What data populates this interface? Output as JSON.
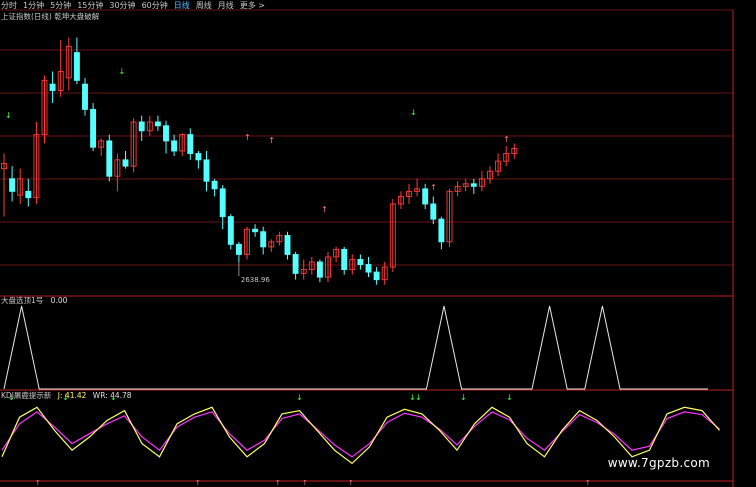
{
  "tabs": [
    "分时",
    "1分钟",
    "5分钟",
    "15分钟",
    "30分钟",
    "60分钟",
    "日线",
    "周线",
    "月线",
    "更多 >"
  ],
  "active_tab": "日线",
  "main_panel": {
    "title": "上证指数(日线) 乾坤大盘破解",
    "low_label": "2638.96"
  },
  "sub1": {
    "title": "大盘选顶1号",
    "value": "0.00"
  },
  "sub2": {
    "title": "KDJ屠鹿提示新",
    "j_label": "J: 41.42",
    "wr_label": "WR: 44.78"
  },
  "watermark": "www.7gpzb.com",
  "colors": {
    "up": "#ff3b3b",
    "down": "#54ffff",
    "grid": "#8b1a1a",
    "k_line": "#ffff66",
    "d_line": "#ff33ff",
    "arrow_green": "#3cff3c",
    "arrow_pink": "#ff7b8a"
  },
  "chart_data": [
    {
      "type": "candlestick",
      "title": "上证指数(日线) 乾坤大盘破解",
      "labeled_low": 2638.96,
      "candles_approx": [
        [
          0,
          158,
          162,
          120,
          170
        ],
        [
          1,
          150,
          140,
          132,
          160
        ],
        [
          2,
          137,
          150,
          130,
          158
        ],
        [
          3,
          140,
          135,
          128,
          150
        ],
        [
          4,
          135,
          185,
          130,
          195
        ],
        [
          5,
          185,
          228,
          178,
          232
        ],
        [
          6,
          225,
          220,
          210,
          235
        ],
        [
          7,
          220,
          235,
          215,
          260
        ],
        [
          8,
          230,
          255,
          220,
          262
        ],
        [
          9,
          250,
          228,
          225,
          262
        ],
        [
          10,
          225,
          205,
          200,
          230
        ],
        [
          11,
          205,
          175,
          172,
          210
        ],
        [
          12,
          175,
          180,
          168,
          182
        ],
        [
          13,
          180,
          152,
          148,
          185
        ],
        [
          14,
          152,
          165,
          140,
          170
        ],
        [
          15,
          165,
          160,
          158,
          172
        ],
        [
          16,
          160,
          195,
          155,
          198
        ],
        [
          17,
          195,
          188,
          180,
          200
        ],
        [
          18,
          188,
          195,
          184,
          200
        ],
        [
          19,
          195,
          192,
          188,
          200
        ],
        [
          20,
          192,
          180,
          170,
          196
        ],
        [
          21,
          180,
          172,
          168,
          185
        ],
        [
          22,
          172,
          185,
          168,
          186
        ],
        [
          23,
          185,
          170,
          165,
          190
        ],
        [
          24,
          170,
          165,
          158,
          172
        ],
        [
          25,
          165,
          148,
          140,
          172
        ],
        [
          26,
          148,
          142,
          136,
          150
        ],
        [
          27,
          142,
          120,
          110,
          145
        ],
        [
          28,
          120,
          98,
          94,
          122
        ],
        [
          29,
          98,
          90,
          84,
          100
        ],
        [
          30,
          90,
          110,
          86,
          112
        ],
        [
          31,
          110,
          108,
          104,
          114
        ],
        [
          32,
          108,
          96,
          90,
          112
        ],
        [
          33,
          96,
          100,
          92,
          102
        ],
        [
          34,
          100,
          105,
          97,
          108
        ],
        [
          35,
          105,
          90,
          86,
          108
        ],
        [
          36,
          90,
          75,
          70,
          92
        ],
        [
          37,
          75,
          78,
          70,
          86
        ],
        [
          38,
          78,
          84,
          74,
          88
        ],
        [
          39,
          84,
          72,
          68,
          86
        ],
        [
          40,
          72,
          88,
          68,
          92
        ],
        [
          41,
          88,
          94,
          84,
          96
        ],
        [
          42,
          94,
          78,
          74,
          96
        ],
        [
          43,
          78,
          86,
          74,
          90
        ],
        [
          44,
          86,
          82,
          78,
          90
        ],
        [
          45,
          82,
          76,
          72,
          88
        ],
        [
          46,
          76,
          70,
          66,
          80
        ],
        [
          47,
          70,
          80,
          66,
          84
        ],
        [
          48,
          80,
          130,
          76,
          134
        ],
        [
          49,
          130,
          136,
          126,
          140
        ],
        [
          50,
          136,
          140,
          130,
          146
        ],
        [
          51,
          140,
          142,
          136,
          150
        ],
        [
          52,
          142,
          130,
          126,
          146
        ],
        [
          53,
          130,
          118,
          114,
          136
        ],
        [
          54,
          118,
          100,
          94,
          120
        ],
        [
          55,
          100,
          140,
          96,
          142
        ],
        [
          56,
          140,
          144,
          136,
          148
        ],
        [
          57,
          144,
          146,
          140,
          150
        ],
        [
          58,
          146,
          144,
          138,
          150
        ],
        [
          59,
          144,
          150,
          140,
          156
        ],
        [
          60,
          150,
          156,
          146,
          160
        ],
        [
          61,
          156,
          164,
          152,
          170
        ],
        [
          62,
          164,
          170,
          160,
          176
        ],
        [
          63,
          170,
          174,
          166,
          178
        ]
      ]
    },
    {
      "type": "line",
      "title": "大盘选顶1号",
      "series": [
        {
          "values": [
            0,
            1,
            0,
            0,
            0,
            0,
            0,
            0,
            0,
            0,
            0,
            0,
            0,
            0,
            0,
            0,
            0,
            0,
            0,
            0,
            0,
            0,
            0,
            0,
            0,
            1,
            0,
            0,
            0,
            0,
            0,
            1,
            0,
            0,
            1,
            0,
            0,
            0,
            0,
            0,
            0
          ]
        }
      ],
      "last_value": 0.0
    },
    {
      "type": "line",
      "title": "KDJ屠鹿提示新",
      "series": [
        {
          "name": "J",
          "values": [
            20,
            80,
            95,
            60,
            30,
            50,
            75,
            90,
            40,
            20,
            70,
            85,
            95,
            50,
            20,
            40,
            85,
            90,
            60,
            30,
            10,
            35,
            80,
            92,
            85,
            60,
            30,
            70,
            95,
            80,
            40,
            20,
            60,
            90,
            75,
            50,
            20,
            30,
            85,
            95,
            90,
            60
          ]
        },
        {
          "name": "WR",
          "values": [
            30,
            70,
            88,
            65,
            40,
            55,
            70,
            82,
            50,
            30,
            65,
            80,
            88,
            55,
            30,
            45,
            78,
            85,
            62,
            38,
            20,
            40,
            72,
            86,
            80,
            62,
            38,
            66,
            88,
            76,
            48,
            30,
            58,
            84,
            72,
            54,
            30,
            36,
            78,
            88,
            84,
            62
          ]
        }
      ],
      "j_value": 41.42,
      "wr_value": 44.78
    }
  ]
}
